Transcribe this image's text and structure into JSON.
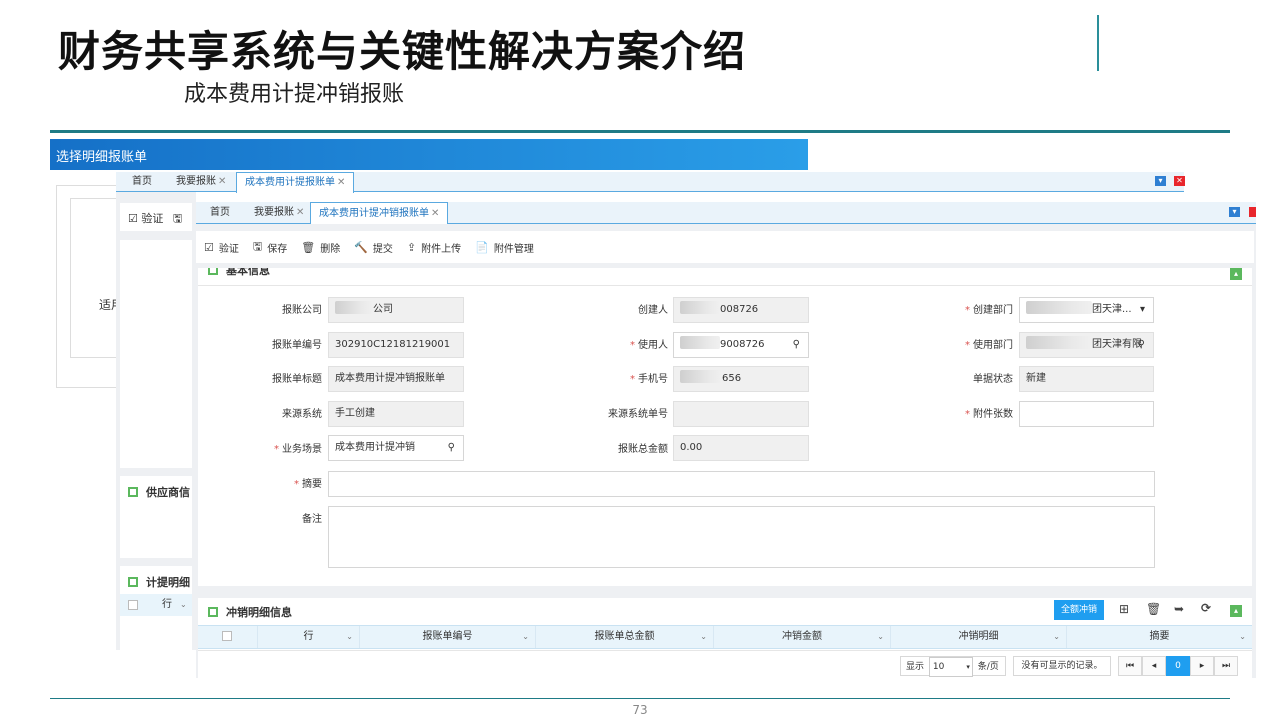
{
  "slide": {
    "title": "财务共享系统与关键性解决方案介绍",
    "subtitle": "成本费用计提冲销报账",
    "page_number": "73"
  },
  "back_dialog": {
    "title": "选择明细报账单",
    "partial_label": "适用"
  },
  "middle_window": {
    "tabs": [
      {
        "label": "首页"
      },
      {
        "label": "我要报账"
      },
      {
        "label": "成本费用计提报账单"
      }
    ],
    "toolbar_first": "验证",
    "section_supplier": "供应商信",
    "section_accrual": "计提明细",
    "row_header": "行"
  },
  "front_window": {
    "tabs": [
      {
        "label": "首页"
      },
      {
        "label": "我要报账"
      },
      {
        "label": "成本费用计提冲销报账单"
      }
    ],
    "toolbar": [
      {
        "icon": "check-square-icon",
        "glyph": "☑",
        "label": "验证"
      },
      {
        "icon": "save-icon",
        "glyph": "🖫",
        "label": "保存"
      },
      {
        "icon": "trash-icon",
        "glyph": "🗑",
        "label": "删除"
      },
      {
        "icon": "gavel-icon",
        "glyph": "🔨",
        "label": "提交"
      },
      {
        "icon": "upload-icon",
        "glyph": "⇪",
        "label": "附件上传"
      },
      {
        "icon": "attachment-icon",
        "glyph": "📄",
        "label": "附件管理"
      }
    ],
    "form": {
      "section_title": "基本信息",
      "fields": {
        "company": {
          "label": "报账公司",
          "value": "公司"
        },
        "creator": {
          "label": "创建人",
          "value": "008726"
        },
        "create_dept": {
          "label": "创建部门",
          "value": "团天津..."
        },
        "doc_no": {
          "label": "报账单编号",
          "value": "302910C12181219001"
        },
        "user": {
          "label": "使用人",
          "value": "9008726"
        },
        "use_dept": {
          "label": "使用部门",
          "value": "团天津有限"
        },
        "doc_title": {
          "label": "报账单标题",
          "value": "成本费用计提冲销报账单"
        },
        "phone": {
          "label": "手机号",
          "value": "656"
        },
        "doc_status": {
          "label": "单据状态",
          "value": "新建"
        },
        "source_sys": {
          "label": "来源系统",
          "value": "手工创建"
        },
        "source_no": {
          "label": "来源系统单号",
          "value": ""
        },
        "attach_count": {
          "label": "附件张数",
          "value": ""
        },
        "biz_scene": {
          "label": "业务场景",
          "value": "成本费用计提冲销"
        },
        "total_amount": {
          "label": "报账总金额",
          "value": "0.00"
        },
        "summary": {
          "label": "摘要",
          "value": ""
        },
        "remark": {
          "label": "备注",
          "value": ""
        }
      }
    },
    "detail": {
      "title": "冲销明细信息",
      "full_writeoff_button": "全额冲销",
      "columns": [
        "行",
        "报账单编号",
        "报账单总金额",
        "冲销金额",
        "冲销明细",
        "摘要"
      ],
      "pager": {
        "show_label": "显示",
        "page_size": "10",
        "per_page_label": "条/页",
        "empty_text": "没有可显示的记录。",
        "current_page": "0"
      }
    }
  },
  "colors": {
    "accent_blue": "#1f9ef0",
    "teal_rule": "#1e7b86",
    "required_red": "#d9534f",
    "section_green": "#5bb85d"
  }
}
